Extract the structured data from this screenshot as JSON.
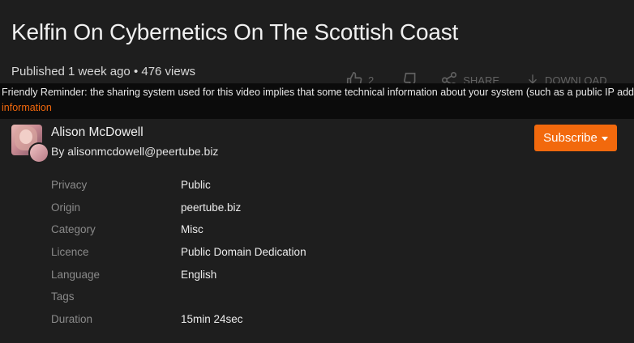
{
  "video": {
    "title": "Kelfin On Cybernetics On The Scottish Coast",
    "published": "Published 1 week ago • 476 views"
  },
  "actions": {
    "likes": "2",
    "share_label": "SHARE",
    "download_label": "DOWNLOAD"
  },
  "reminder": {
    "text": "Friendly Reminder: the sharing system used for this video implies that some technical information about your system (such as a public IP address",
    "link": "information"
  },
  "account": {
    "name": "Alison McDowell",
    "handle": "By alisonmcdowell@peertube.biz",
    "subscribe_label": "Subscribe"
  },
  "attributes": [
    {
      "label": "Privacy",
      "value": "Public"
    },
    {
      "label": "Origin",
      "value": "peertube.biz"
    },
    {
      "label": "Category",
      "value": "Misc"
    },
    {
      "label": "Licence",
      "value": "Public Domain Dedication"
    },
    {
      "label": "Language",
      "value": "English"
    },
    {
      "label": "Tags",
      "value": ""
    },
    {
      "label": "Duration",
      "value": "15min 24sec"
    }
  ],
  "colors": {
    "accent": "#f2690d",
    "background": "#1e1e1e"
  }
}
